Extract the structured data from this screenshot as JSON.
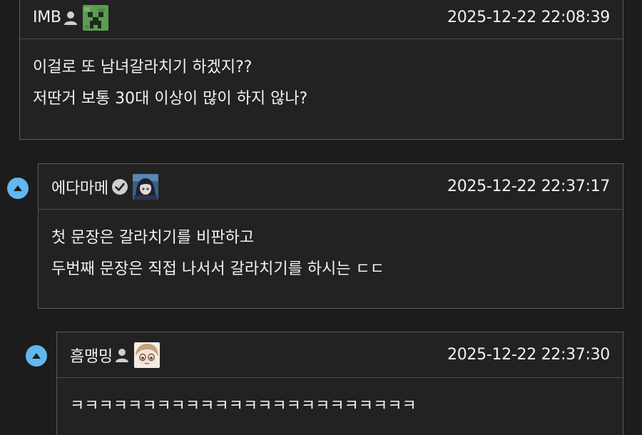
{
  "comments": [
    {
      "author": "IMB",
      "author_icon": "user-icon",
      "avatar": "green-pixel-creeper-avatar",
      "timestamp": "2025-12-22 22:08:39",
      "lines": [
        "이걸로 또 남녀갈라치기 하겠지??",
        "저딴거 보통 30대 이상이 많이 하지 않나?"
      ]
    },
    {
      "author": "에다마메",
      "author_icon": "verified-check-icon",
      "avatar": "anime-character-avatar",
      "timestamp": "2025-12-22 22:37:17",
      "lines": [
        "첫 문장은 갈라치기를 비판하고",
        "두번째 문장은 직접 나서서 갈라치기를 하시는 ㄷㄷ"
      ]
    },
    {
      "author": "흠맹밍",
      "author_icon": "user-icon",
      "avatar": "chibi-face-avatar",
      "timestamp": "2025-12-22 22:37:30",
      "lines": [
        "ㅋㅋㅋㅋㅋㅋㅋㅋㅋㅋㅋㅋㅋㅋㅋㅋㅋㅋㅋㅋㅋㅋㅋㅋ"
      ]
    }
  ],
  "colors": {
    "background": "#1c1c1c",
    "card": "#222222",
    "border": "#5a5a5a",
    "collapse_button": "#62b7f0"
  }
}
